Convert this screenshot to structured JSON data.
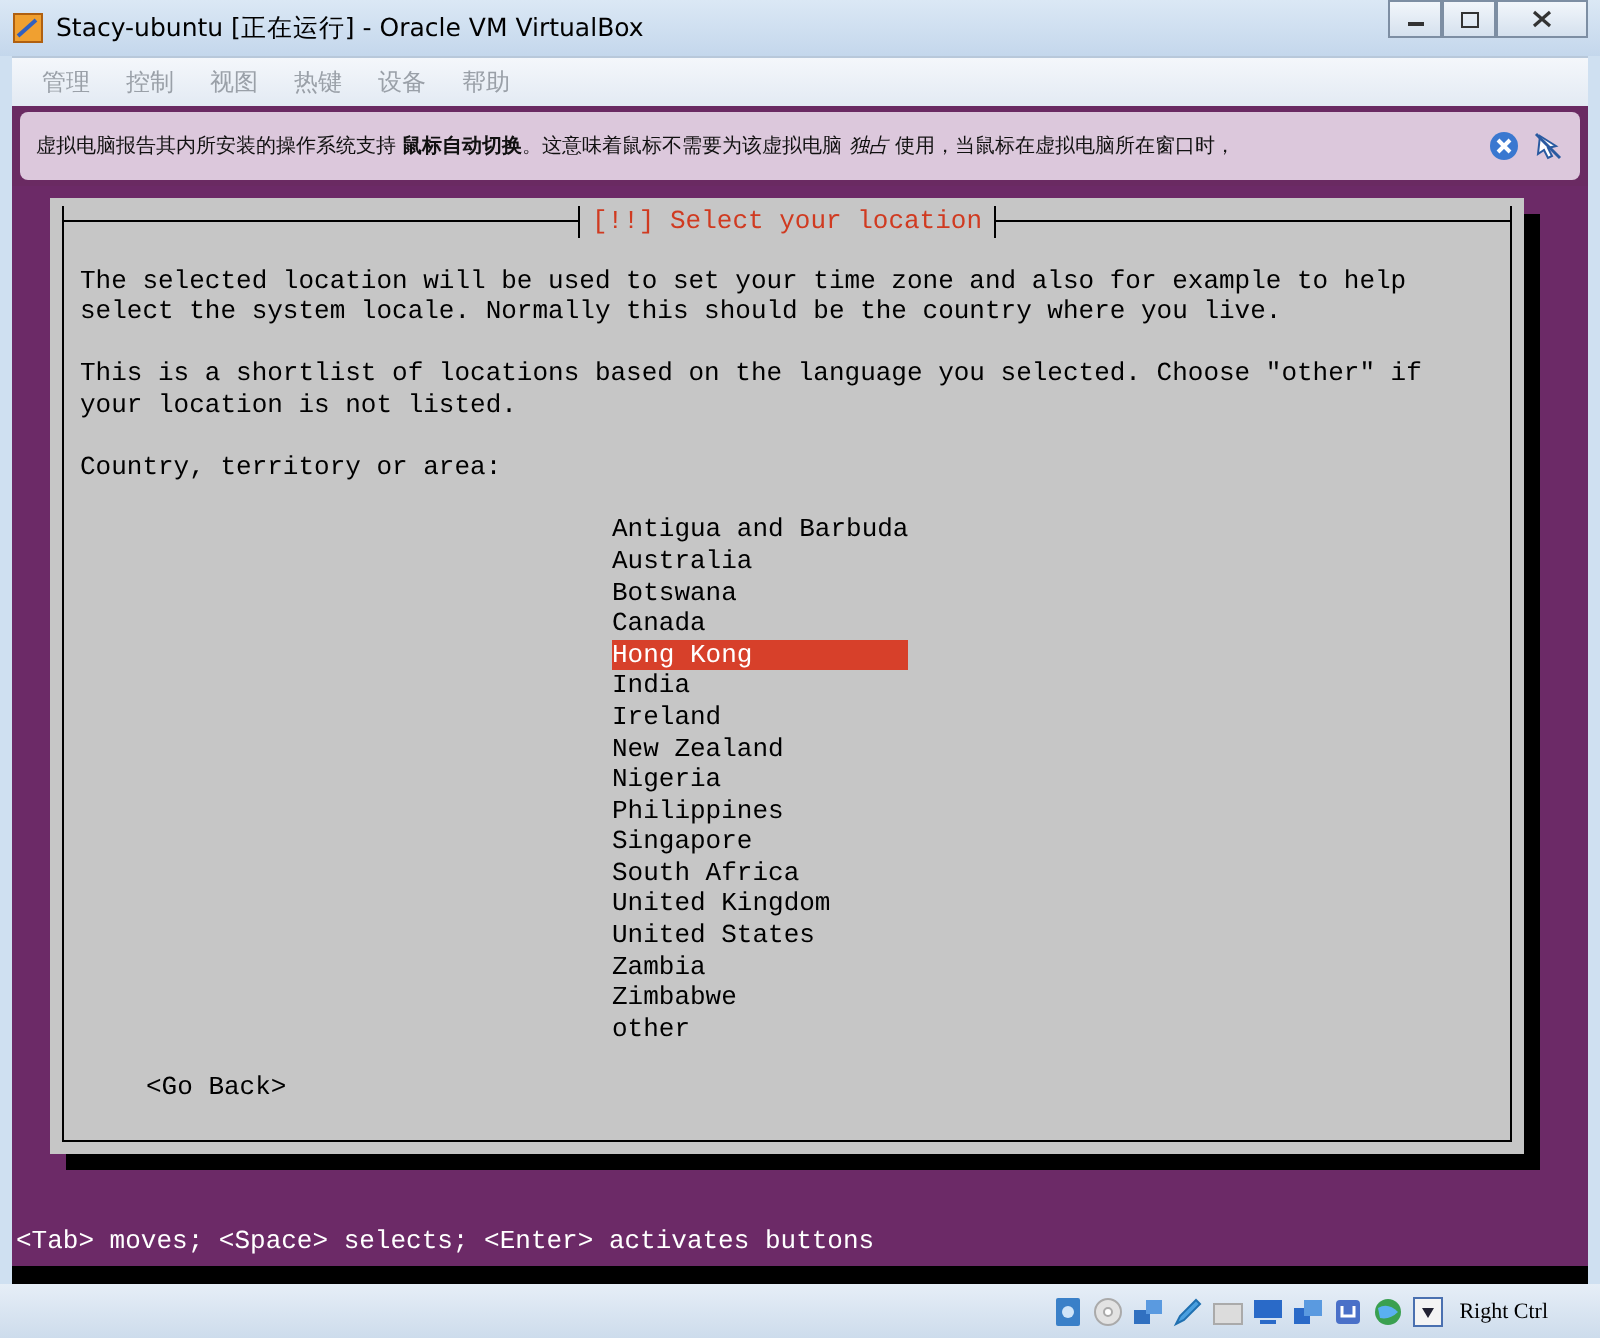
{
  "window": {
    "title": "Stacy-ubuntu [正在运行] - Oracle VM VirtualBox"
  },
  "menu": [
    {
      "label": "管理",
      "disabled": true
    },
    {
      "label": "控制",
      "disabled": true
    },
    {
      "label": "视图",
      "disabled": true
    },
    {
      "label": "热键",
      "disabled": true
    },
    {
      "label": "设备",
      "disabled": true
    },
    {
      "label": "帮助",
      "disabled": true
    }
  ],
  "info_bar": {
    "message": "虚拟电脑报告其内所安装的操作系统支持 **鼠标自动切换**。这意味着鼠标不需要为该虚拟电脑 *独占* 使用，当鼠标在虚拟电脑所在窗口时，"
  },
  "installer": {
    "dialog_title": "[!!] Select your location",
    "paragraphs": [
      "The selected location will be used to set your time zone and also for example to help select the system locale. Normally this should be the country where you live.",
      "This is a shortlist of locations based on the language you selected. Choose \"other\" if your location is not listed."
    ],
    "prompt": "Country, territory or area:",
    "locations": [
      {
        "label": "Antigua and Barbuda",
        "selected": false
      },
      {
        "label": "Australia",
        "selected": false
      },
      {
        "label": "Botswana",
        "selected": false
      },
      {
        "label": "Canada",
        "selected": false
      },
      {
        "label": "Hong Kong",
        "selected": true
      },
      {
        "label": "India",
        "selected": false
      },
      {
        "label": "Ireland",
        "selected": false
      },
      {
        "label": "New Zealand",
        "selected": false
      },
      {
        "label": "Nigeria",
        "selected": false
      },
      {
        "label": "Philippines",
        "selected": false
      },
      {
        "label": "Singapore",
        "selected": false
      },
      {
        "label": "South Africa",
        "selected": false
      },
      {
        "label": "United Kingdom",
        "selected": false
      },
      {
        "label": "United States",
        "selected": false
      },
      {
        "label": "Zambia",
        "selected": false
      },
      {
        "label": "Zimbabwe",
        "selected": false
      },
      {
        "label": "other",
        "selected": false
      }
    ],
    "go_back": "<Go Back>",
    "help_line": "<Tab> moves; <Space> selects; <Enter> activates buttons"
  },
  "status_bar": {
    "host_key": "Right Ctrl"
  }
}
